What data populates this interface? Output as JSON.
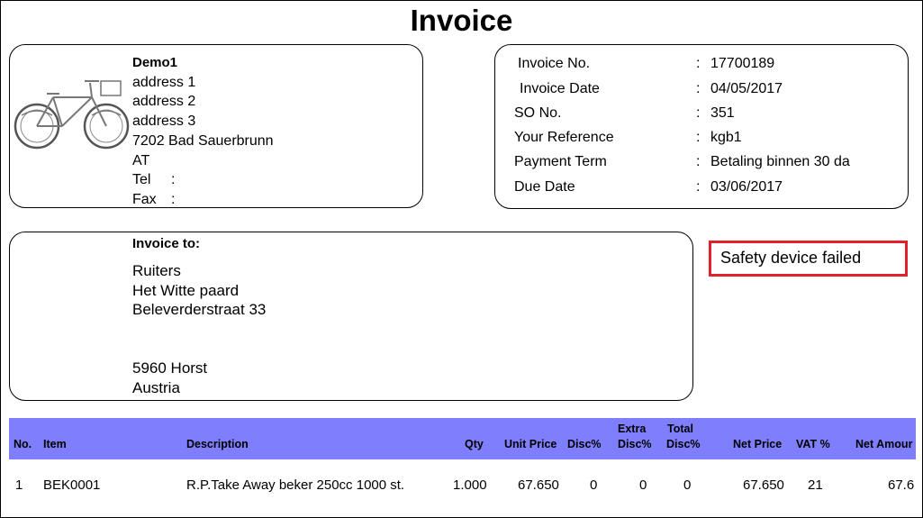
{
  "title": "Invoice",
  "company": {
    "name": "Demo1",
    "address_lines": [
      "address 1",
      "address 2",
      "address 3",
      "7202 Bad Sauerbrunn",
      "AT"
    ],
    "tel_label": "Tel",
    "fax_label": "Fax",
    "tel_value": ":",
    "fax_value": ":"
  },
  "meta": [
    {
      "label": "Invoice No.",
      "value": "17700189"
    },
    {
      "label": "Invoice Date",
      "value": "04/05/2017"
    },
    {
      "label": "SO No.",
      "value": "351"
    },
    {
      "label": "Your Reference",
      "value": "kgb1"
    },
    {
      "label": "Payment Term",
      "value": "Betaling binnen 30 da"
    },
    {
      "label": "Due Date",
      "value": "03/06/2017"
    }
  ],
  "meta_separator": ":",
  "bill_to": {
    "heading": "Invoice to:",
    "lines": [
      "Ruiters",
      "Het Witte paard",
      "Beleverderstraat 33",
      "",
      "",
      "5960 Horst",
      "Austria"
    ]
  },
  "alert": "Safety device failed",
  "table": {
    "headers": {
      "no": "No.",
      "item": "Item",
      "description": "Description",
      "qty": "Qty",
      "unit_price": "Unit Price",
      "disc": "Disc%",
      "extra_disc_1": "Extra",
      "extra_disc_2": "Disc%",
      "total_disc_1": "Total",
      "total_disc_2": "Disc%",
      "net_price": "Net Price",
      "vat": "VAT %",
      "net_amount": "Net Amour"
    },
    "rows": [
      {
        "no": "1",
        "item": "BEK0001",
        "description": "R.P.Take Away beker 250cc 1000 st.",
        "qty": "1.000",
        "unit_price": "67.650",
        "disc": "0",
        "extra_disc": "0",
        "total_disc": "0",
        "net_price": "67.650",
        "vat": "21",
        "net_amount": "67.6"
      }
    ]
  }
}
